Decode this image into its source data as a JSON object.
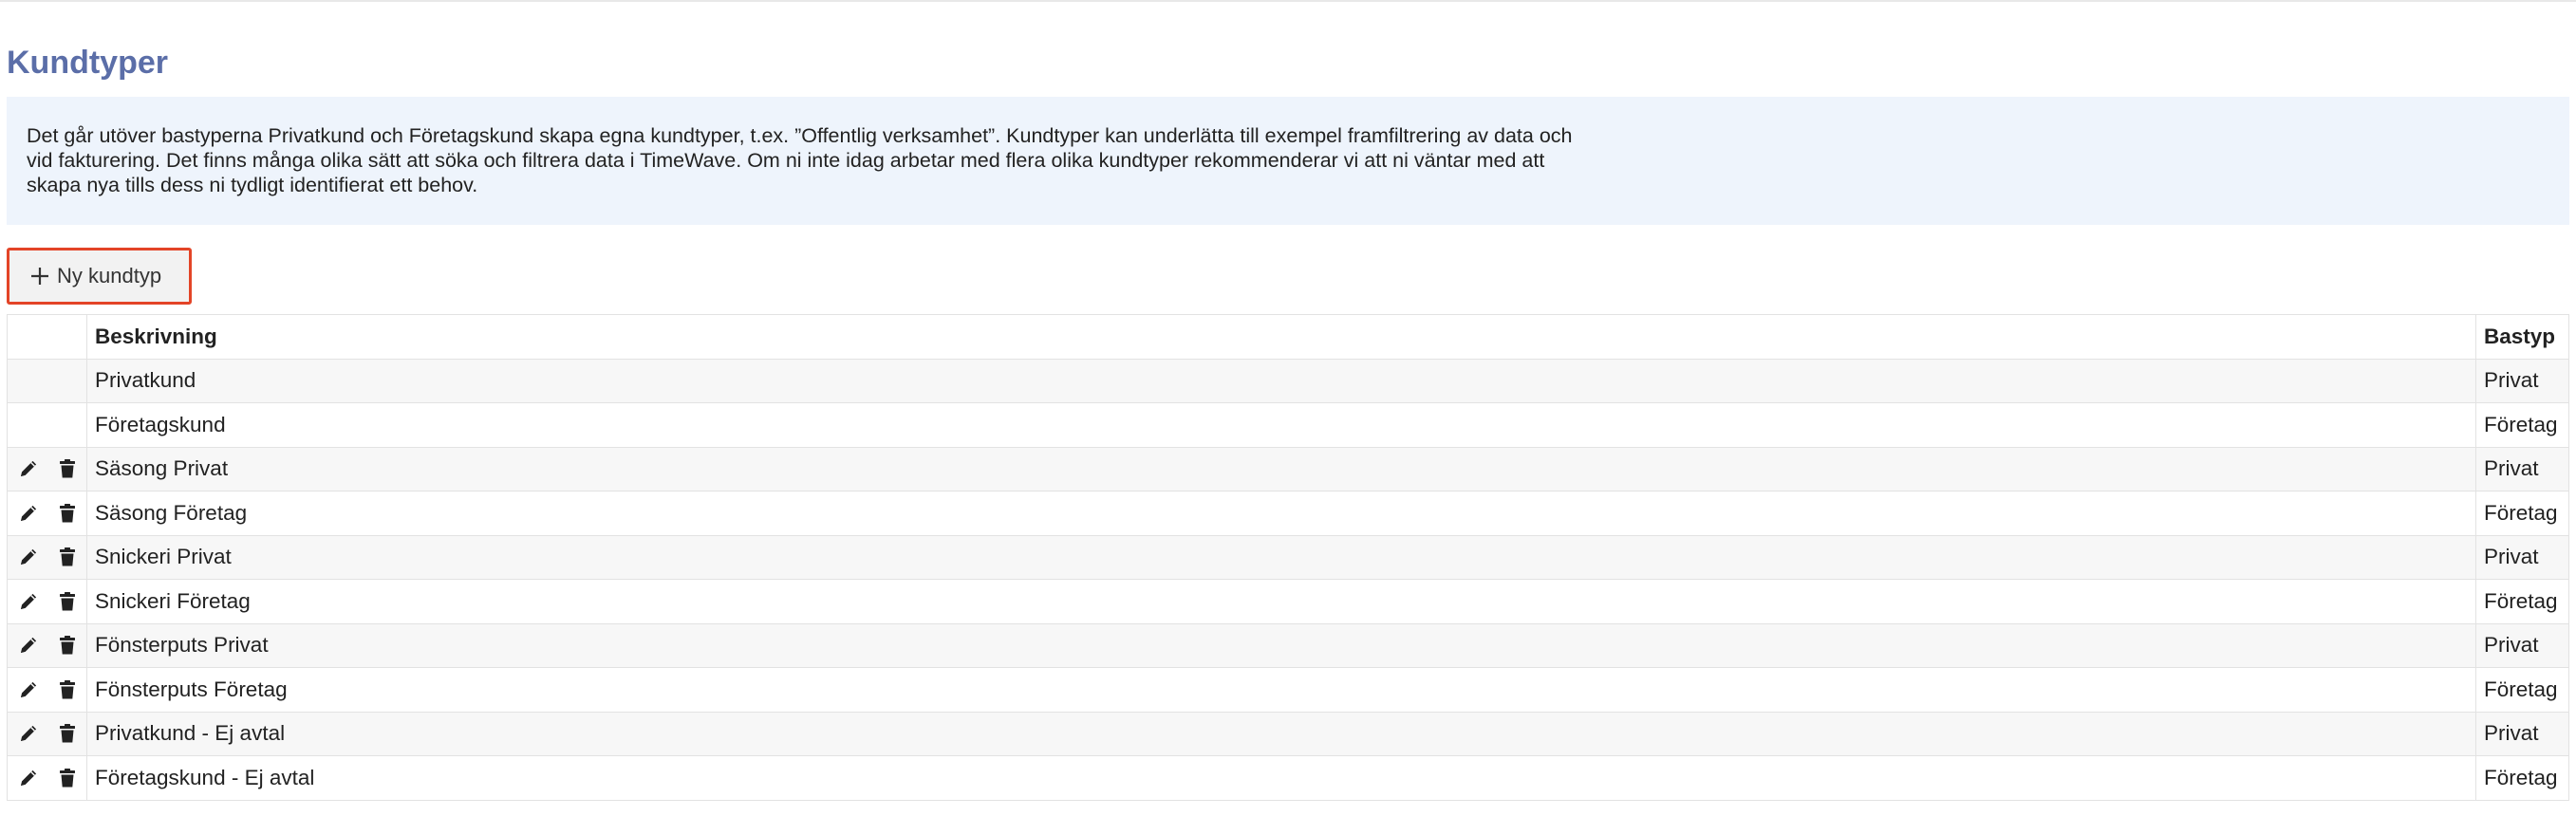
{
  "page": {
    "title": "Kundtyper",
    "info_text": "Det går utöver bastyperna Privatkund och Företagskund skapa egna kundtyper, t.ex. ”Offentlig verksamhet”. Kundtyper kan underlätta till exempel framfiltrering av data och vid fakturering. Det finns många olika sätt att söka och filtrera data i TimeWave. Om ni inte idag arbetar med flera olika kundtyper rekommenderar vi att ni väntar med att skapa nya tills dess ni tydligt identifierat ett behov.",
    "new_button_label": "Ny kundtyp"
  },
  "table": {
    "headers": {
      "description": "Beskrivning",
      "basetype": "Bastyp"
    },
    "rows": [
      {
        "description": "Privatkund",
        "basetype": "Privat",
        "editable": false
      },
      {
        "description": "Företagskund",
        "basetype": "Företag",
        "editable": false
      },
      {
        "description": "Säsong Privat",
        "basetype": "Privat",
        "editable": true
      },
      {
        "description": "Säsong Företag",
        "basetype": "Företag",
        "editable": true
      },
      {
        "description": "Snickeri Privat",
        "basetype": "Privat",
        "editable": true
      },
      {
        "description": "Snickeri Företag",
        "basetype": "Företag",
        "editable": true
      },
      {
        "description": "Fönsterputs Privat",
        "basetype": "Privat",
        "editable": true
      },
      {
        "description": "Fönsterputs Företag",
        "basetype": "Företag",
        "editable": true
      },
      {
        "description": "Privatkund - Ej avtal",
        "basetype": "Privat",
        "editable": true
      },
      {
        "description": "Företagskund - Ej avtal",
        "basetype": "Företag",
        "editable": true
      }
    ]
  },
  "icons": {
    "add": "plus-icon",
    "edit": "pencil-icon",
    "delete": "trash-icon"
  },
  "colors": {
    "title": "#5b6ea8",
    "info_bg": "#eef4fc",
    "highlight_border": "#e34427"
  }
}
